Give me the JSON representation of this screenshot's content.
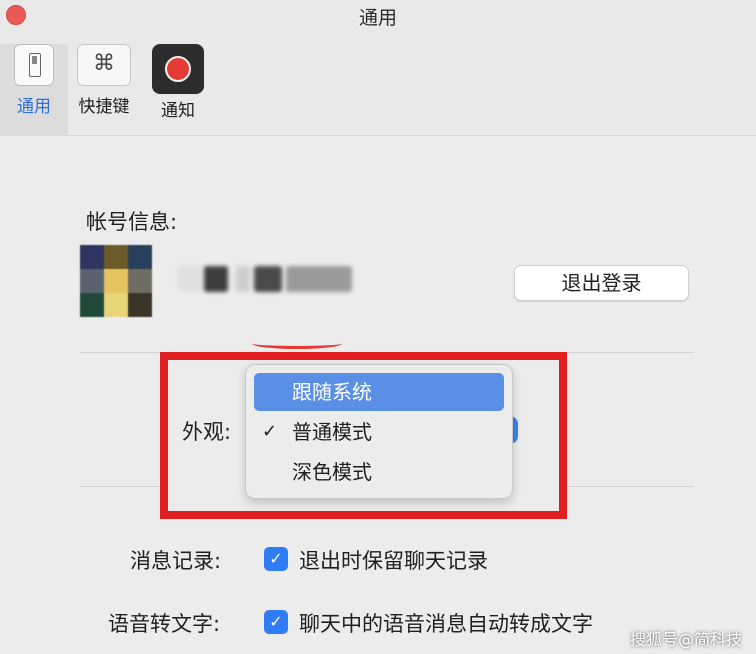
{
  "window": {
    "title": "通用"
  },
  "toolbar": {
    "items": [
      {
        "label": "通用",
        "icon": "general-switch-icon",
        "active": true
      },
      {
        "label": "快捷键",
        "icon": "command-key-icon",
        "active": false
      },
      {
        "label": "通知",
        "icon": "notification-record-icon",
        "active": false
      }
    ],
    "shortcut_glyph": "⌘"
  },
  "account": {
    "heading": "帐号信息:",
    "logout_label": "退出登录"
  },
  "appearance": {
    "label": "外观:",
    "menu": {
      "items": [
        {
          "label": "跟随系统",
          "highlighted": true,
          "checked": false
        },
        {
          "label": "普通模式",
          "highlighted": false,
          "checked": true
        },
        {
          "label": "深色模式",
          "highlighted": false,
          "checked": false
        }
      ],
      "check_glyph": "✓"
    }
  },
  "settings": {
    "message_history": {
      "label": "消息记录:",
      "checked": true,
      "text": "退出时保留聊天记录"
    },
    "voice_to_text": {
      "label": "语音转文字:",
      "checked": true,
      "text": "聊天中的语音消息自动转成文字"
    },
    "check_glyph": "✓"
  },
  "watermark": "搜狐号@简科技",
  "colors": {
    "accent": "#2f7cf6",
    "menu_highlight": "#5a8fe6",
    "annotation_red": "#e02020",
    "close_button": "#ec5a55"
  }
}
